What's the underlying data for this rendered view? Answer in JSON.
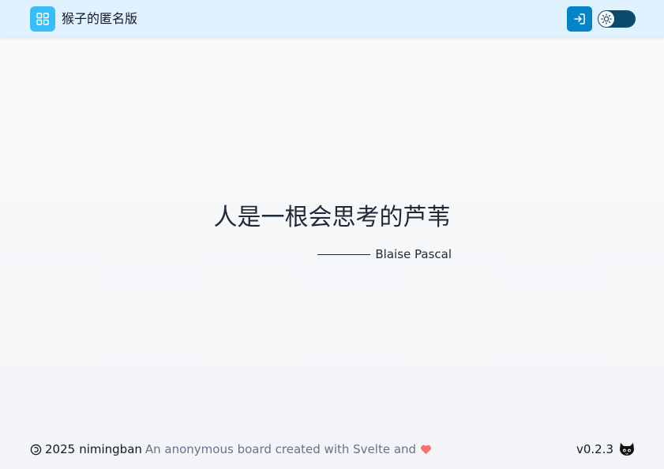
{
  "header": {
    "site_title": "猴子的匿名版",
    "icons": {
      "logo": "grid-icon",
      "login": "login-icon",
      "theme": "sun-icon"
    },
    "colors": {
      "header_bg": "#e0f2fe",
      "logo_bg": "#38bdf8",
      "login_bg": "#0284c7",
      "toggle_bg": "#0c4a6e"
    }
  },
  "main": {
    "quote": "人是一根会思考的芦苇",
    "author": "Blaise Pascal"
  },
  "footer": {
    "year": "2025",
    "site_name": "nimingban",
    "tagline": "An anonymous board created with Svelte and",
    "version": "v0.2.3",
    "icons": {
      "copyright": "copyleft-icon",
      "heart": "heart-icon",
      "github": "github-icon"
    },
    "colors": {
      "heart": "#f87171",
      "tagline": "#64748b"
    }
  }
}
